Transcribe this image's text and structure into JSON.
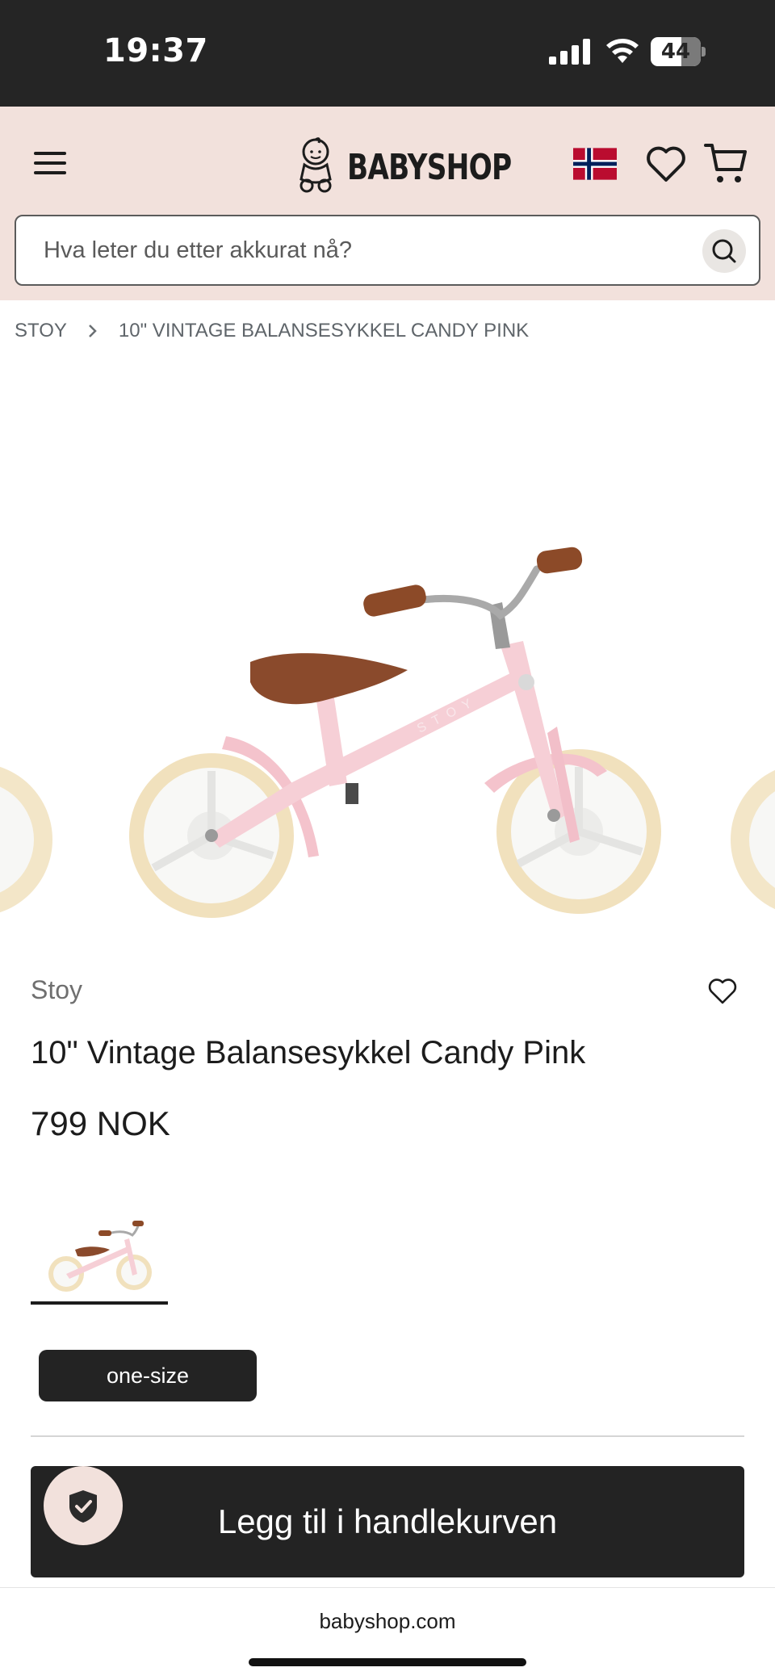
{
  "status_bar": {
    "time": "19:37",
    "battery": "44",
    "icons": [
      "signal-icon",
      "wifi-icon",
      "battery-icon"
    ]
  },
  "header": {
    "logo_text": "BABYSHOP",
    "icons": [
      "menu-icon",
      "baby-logo-icon",
      "norway-flag-icon",
      "heart-icon",
      "cart-icon"
    ],
    "search": {
      "placeholder": "Hva leter du etter akkurat nå?"
    },
    "background_color": "#f2e1dc"
  },
  "breadcrumb": {
    "items": [
      "STOY",
      "10\" VINTAGE BALANSESYKKEL CANDY PINK"
    ]
  },
  "product": {
    "brand": "Stoy",
    "title": "10\" Vintage Balansesykkel Candy Pink",
    "price": "799 NOK",
    "size_options": [
      "one-size"
    ],
    "selected_size": "one-size",
    "add_to_cart_label": "Legg til i handlekurven",
    "frame_color": "#f6cfd6",
    "saddle_color": "#8a4a2c"
  },
  "browser": {
    "url": "babyshop.com"
  }
}
